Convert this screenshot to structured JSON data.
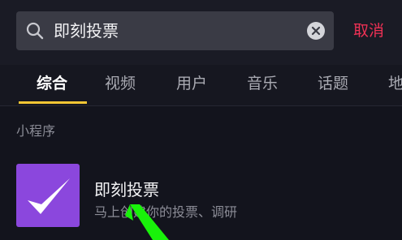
{
  "search": {
    "query": "即刻投票",
    "cancel_label": "取消"
  },
  "tabs": [
    {
      "label": "综合",
      "active": true
    },
    {
      "label": "视频",
      "active": false
    },
    {
      "label": "用户",
      "active": false
    },
    {
      "label": "音乐",
      "active": false
    },
    {
      "label": "话题",
      "active": false
    },
    {
      "label": "地",
      "active": false
    }
  ],
  "section": {
    "title": "小程序"
  },
  "result": {
    "title": "即刻投票",
    "description": "马上创建你的投票、调研",
    "logo_icon": "checkmark-icon"
  },
  "colors": {
    "background": "#13141d",
    "search_box": "#3a3b45",
    "cancel": "#ef3155",
    "tab_underline": "#f6c634",
    "logo_bg": "#8b47dd",
    "pointer_arrow": "#19f20a"
  }
}
